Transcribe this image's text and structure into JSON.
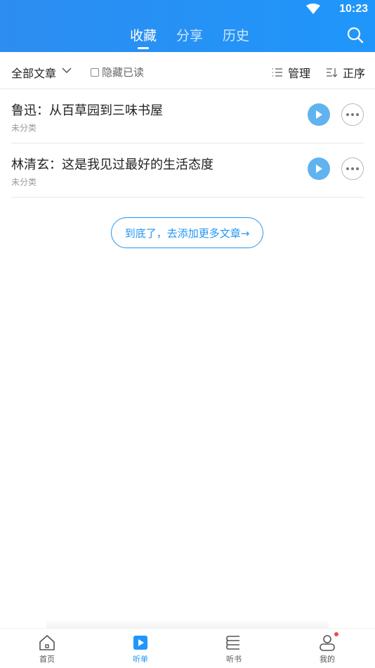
{
  "status_bar": {
    "time": "10:23"
  },
  "header": {
    "tabs": [
      {
        "label": "收藏",
        "active": true
      },
      {
        "label": "分享",
        "active": false
      },
      {
        "label": "历史",
        "active": false
      }
    ],
    "search_icon": "search-icon"
  },
  "toolbar": {
    "filter_label": "全部文章",
    "hide_read_label": "隐藏已读",
    "manage_label": "管理",
    "order_label": "正序"
  },
  "articles": [
    {
      "title": "鲁迅：从百草园到三味书屋",
      "category": "未分类"
    },
    {
      "title": "林清玄：这是我见过最好的生活态度",
      "category": "未分类"
    }
  ],
  "end_link": "到底了，去添加更多文章→",
  "bottom_nav": [
    {
      "label": "首页",
      "icon": "home-icon",
      "active": false
    },
    {
      "label": "听单",
      "icon": "play-list-icon",
      "active": true
    },
    {
      "label": "听书",
      "icon": "book-icon",
      "active": false
    },
    {
      "label": "我的",
      "icon": "profile-icon",
      "active": false,
      "badge": true
    }
  ],
  "colors": {
    "accent": "#1f96fb",
    "play": "#60b3ee",
    "badge": "#f04a4a"
  }
}
